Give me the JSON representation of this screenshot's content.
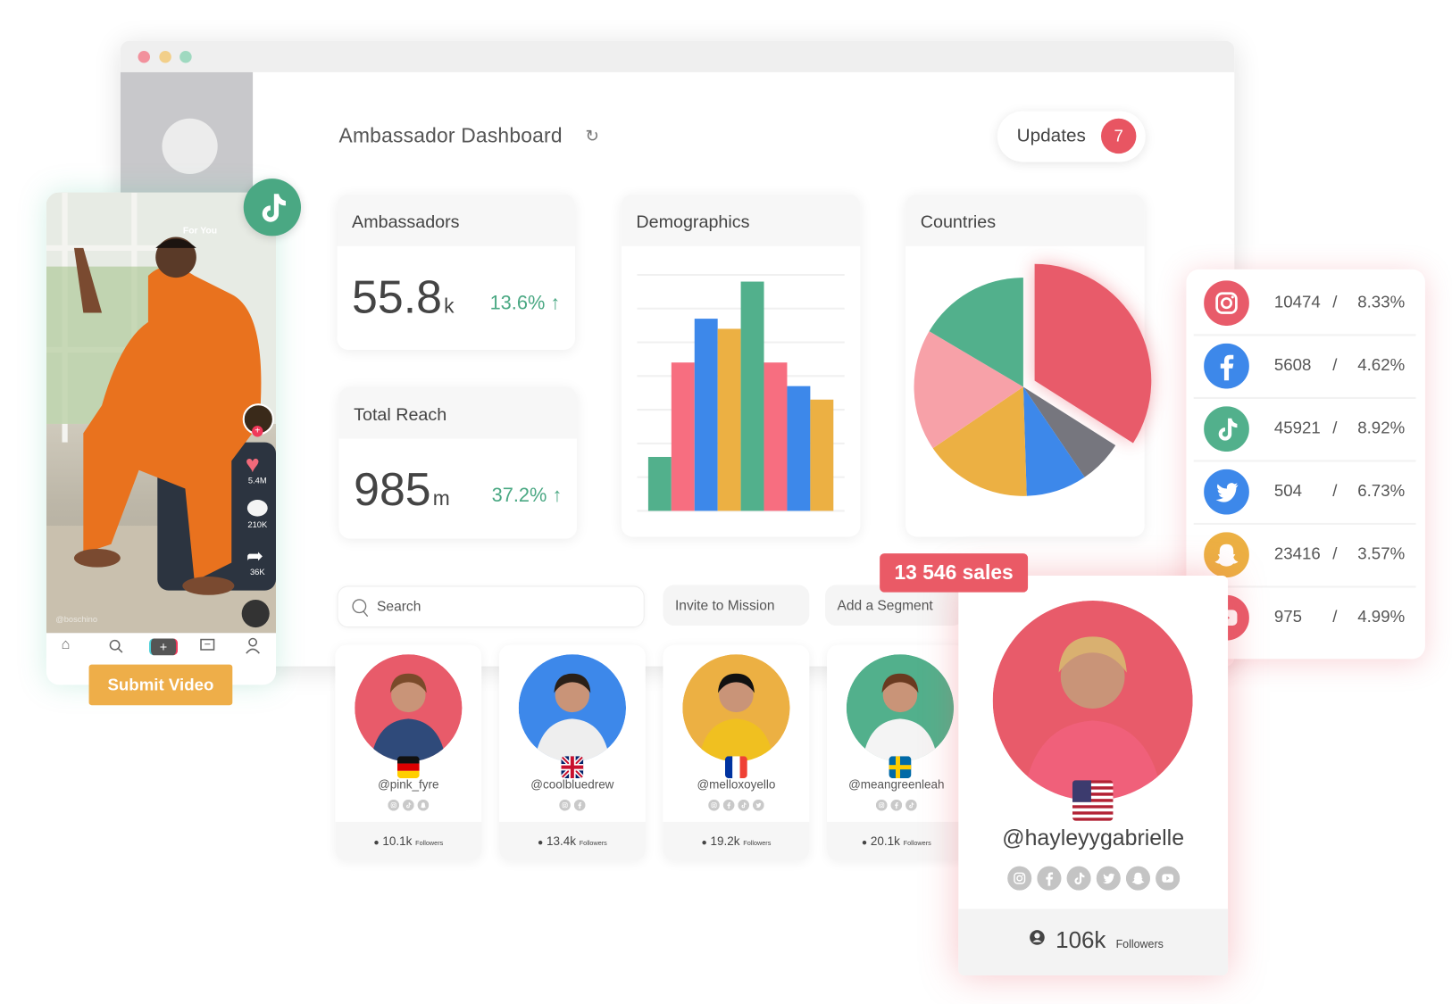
{
  "window": {
    "dots": [
      "#f2919d",
      "#f2cf8a",
      "#9fd9c0"
    ]
  },
  "header": {
    "title": "Ambassador Dashboard",
    "refresh_icon": "refresh-icon",
    "updates_label": "Updates",
    "updates_count": "7"
  },
  "ambassadors": {
    "title": "Ambassadors",
    "value": "55.8",
    "unit": "k",
    "change": "13.6% ↑"
  },
  "total_reach": {
    "title": "Total Reach",
    "value": "985",
    "unit": "m",
    "change": "37.2% ↑"
  },
  "colors": {
    "green": "#52b08c",
    "red": "#e85b6a",
    "pink": "#f7a1a8",
    "barpink": "#f76e80",
    "blue": "#3d88ea",
    "yellow": "#ecb043",
    "grey": "#76767e",
    "accent": "#ea5a66"
  },
  "chart_data": [
    {
      "type": "bar",
      "title": "Demographics",
      "grid": true,
      "values": [
        1.6,
        4.4,
        5.7,
        5.4,
        6.8,
        4.4,
        3.7,
        3.3
      ],
      "colors": [
        "#52b08c",
        "#f76e80",
        "#3d88ea",
        "#ecb043",
        "#52b08c",
        "#f76e80",
        "#3d88ea",
        "#ecb043"
      ],
      "ylim": [
        0,
        7
      ]
    },
    {
      "type": "pie",
      "title": "Countries",
      "values": [
        34,
        6.5,
        9,
        16,
        18,
        16.5
      ],
      "colors": [
        "#e85b6a",
        "#76767e",
        "#3d88ea",
        "#ecb043",
        "#f7a1a8",
        "#52b08c"
      ],
      "exploded": [
        0
      ]
    }
  ],
  "social_stats": [
    {
      "icon": "instagram",
      "color": "#e85b6a",
      "count": "10474",
      "sep": "/",
      "rate": "8.33%"
    },
    {
      "icon": "facebook",
      "color": "#3d88ea",
      "count": "5608",
      "sep": "/",
      "rate": "4.62%"
    },
    {
      "icon": "tiktok",
      "color": "#52b08c",
      "count": "45921",
      "sep": "/",
      "rate": "8.92%"
    },
    {
      "icon": "twitter",
      "color": "#3d88ea",
      "count": "504",
      "sep": "/",
      "rate": "6.73%"
    },
    {
      "icon": "snapchat",
      "color": "#ecb043",
      "count": "23416",
      "sep": "/",
      "rate": "3.57%"
    },
    {
      "icon": "youtube",
      "color": "#e85b6a",
      "count": "975",
      "sep": "/",
      "rate": "4.99%"
    }
  ],
  "toolbar": {
    "search_placeholder": "Search",
    "invite": "Invite to Mission",
    "segment": "Add a Segment"
  },
  "sales_badge": "13 546 sales",
  "ambassador_cards": [
    {
      "handle": "@pink_fyre",
      "flag": "germany",
      "ring": "#e85b6a",
      "icons": [
        "instagram",
        "tiktok",
        "snapchat"
      ],
      "followers": "10.1k",
      "followers_label": "Followers"
    },
    {
      "handle": "@coolbluedrew",
      "flag": "uk",
      "ring": "#3d88ea",
      "icons": [
        "instagram",
        "facebook"
      ],
      "followers": "13.4k",
      "followers_label": "Followers"
    },
    {
      "handle": "@melloxoyello",
      "flag": "france",
      "ring": "#ecb043",
      "icons": [
        "instagram",
        "facebook",
        "tiktok",
        "twitter"
      ],
      "followers": "19.2k",
      "followers_label": "Followers"
    },
    {
      "handle": "@meangreenleah",
      "flag": "sweden",
      "ring": "#52b08c",
      "icons": [
        "instagram",
        "facebook",
        "tiktok"
      ],
      "followers": "20.1k",
      "followers_label": "Followers"
    }
  ],
  "featured": {
    "handle": "@hayleyygabrielle",
    "flag": "usa",
    "ring": "#e85b6a",
    "icons": [
      "instagram",
      "facebook",
      "tiktok",
      "twitter",
      "snapchat",
      "youtube"
    ],
    "followers": "106k",
    "followers_label": "Followers"
  },
  "phone": {
    "tab": "For You",
    "likes": "5.4M",
    "comments": "210K",
    "shares": "36K",
    "username": "@boschino",
    "submit": "Submit Video"
  }
}
